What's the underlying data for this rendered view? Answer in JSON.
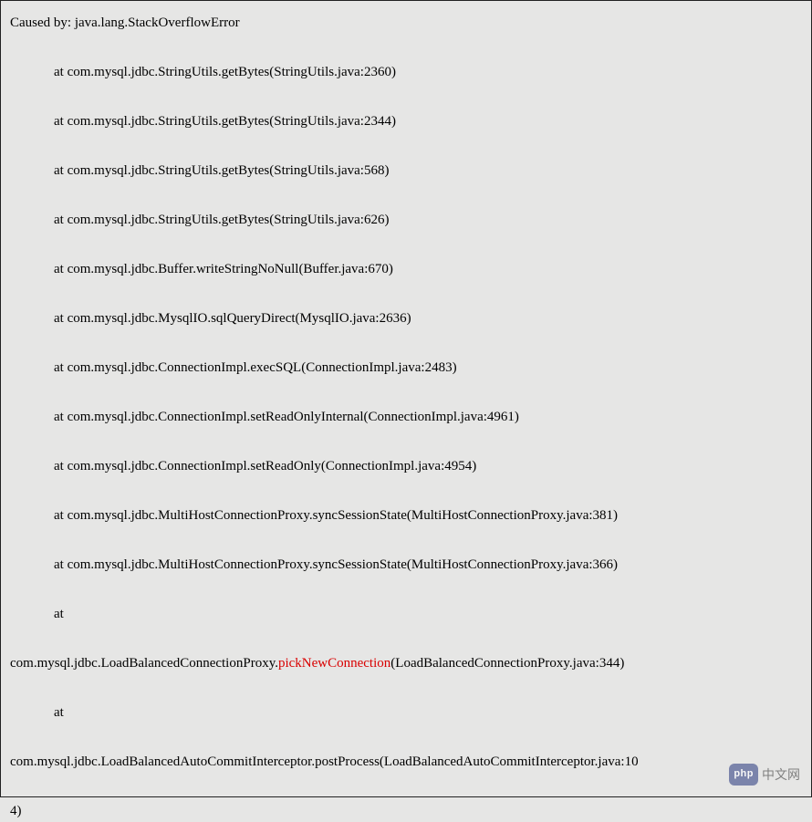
{
  "exception": "Caused by: java.lang.StackOverflowError",
  "lines": [
    "at com.mysql.jdbc.StringUtils.getBytes(StringUtils.java:2360)",
    "at com.mysql.jdbc.StringUtils.getBytes(StringUtils.java:2344)",
    "at com.mysql.jdbc.StringUtils.getBytes(StringUtils.java:568)",
    "at com.mysql.jdbc.StringUtils.getBytes(StringUtils.java:626)",
    "at com.mysql.jdbc.Buffer.writeStringNoNull(Buffer.java:670)",
    "at com.mysql.jdbc.MysqlIO.sqlQueryDirect(MysqlIO.java:2636)",
    "at com.mysql.jdbc.ConnectionImpl.execSQL(ConnectionImpl.java:2483)",
    "at com.mysql.jdbc.ConnectionImpl.setReadOnlyInternal(ConnectionImpl.java:4961)",
    "at com.mysql.jdbc.ConnectionImpl.setReadOnly(ConnectionImpl.java:4954)",
    "at com.mysql.jdbc.MultiHostConnectionProxy.syncSessionState(MultiHostConnectionProxy.java:381)",
    "at com.mysql.jdbc.MultiHostConnectionProxy.syncSessionState(MultiHostConnectionProxy.java:366)"
  ],
  "wrap1": {
    "at": "at",
    "pre": "com.mysql.jdbc.LoadBalancedConnectionProxy.",
    "highlight": "pickNewConnection",
    "post": "(LoadBalancedConnectionProxy.java:344)"
  },
  "wrap2": {
    "at": "at",
    "pre": "com.mysql.jdbc.LoadBalancedAutoCommitInterceptor.postProcess(LoadBalancedAutoCommitInterceptor.java:10",
    "trail": "4)"
  },
  "watermark": {
    "badge": "php",
    "text": "中文网"
  }
}
